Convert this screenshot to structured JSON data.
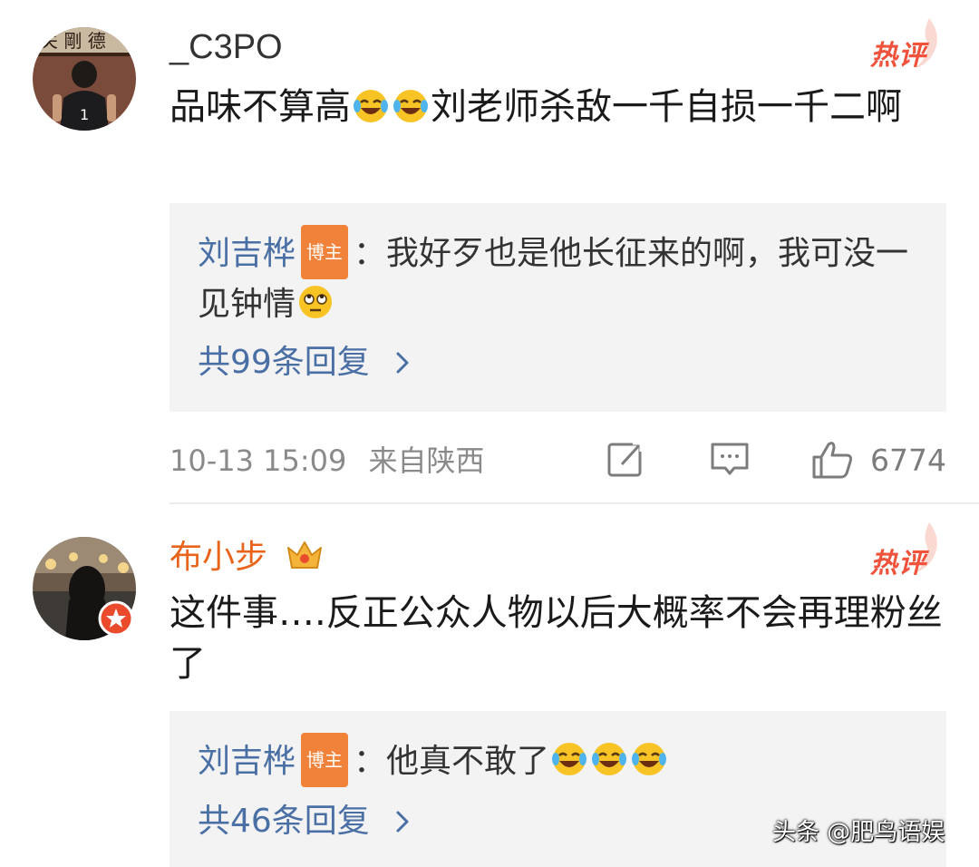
{
  "comments": [
    {
      "username": "_C3PO",
      "hot_label": "热评",
      "text_a": "品味不算高",
      "text_emoji": [
        "laugh-cry-emoji",
        "laugh-cry-emoji"
      ],
      "text_b": "刘老师杀敌一千自损一千二啊",
      "reply": {
        "author": "刘吉桦",
        "badge": "博主",
        "text": "：我好歹也是他长征来的啊，我可没一见钟情",
        "emoji": [
          "eye-roll-emoji"
        ]
      },
      "reply_count": "共99条回复",
      "timestamp": "10-13 15:09",
      "location": "来自陕西",
      "likes": "6774"
    },
    {
      "username": "布小步",
      "hot_label": "热评",
      "text_a": "这件事….反正公众人物以后大概率不会再理粉丝了",
      "reply": {
        "author": "刘吉桦",
        "badge": "博主",
        "text": "：他真不敢了",
        "emoji": [
          "laugh-cry-emoji",
          "laugh-cry-emoji",
          "laugh-cry-emoji"
        ]
      },
      "reply_count": "共46条回复"
    }
  ],
  "watermark": "头条 @肥鸟语娱",
  "colors": {
    "username_orange": "#e8641b",
    "reply_author_blue": "#4a6fa5",
    "hot_red": "#f0523c",
    "badge_orange": "#f0823a",
    "reply_bg": "#f3f3f3"
  }
}
